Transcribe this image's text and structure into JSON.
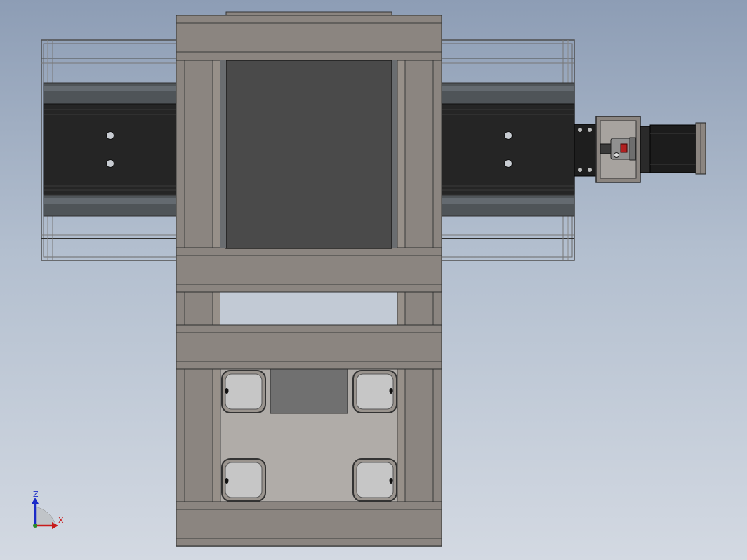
{
  "viewport": {
    "background_top": "#8d9db5",
    "background_bottom": "#d3d9e2"
  },
  "model": {
    "frame_color": "#8b8580",
    "rail_color": "#252525",
    "tube_color": "#505458",
    "carriage_color": "#4a4a4a",
    "motor_color": "#1c1c1c",
    "coupling_accent": "#b02020"
  },
  "triad": {
    "z_label": "Z",
    "x_label": "X",
    "z_color": "#1a2ac8",
    "x_color": "#c81a1a"
  }
}
